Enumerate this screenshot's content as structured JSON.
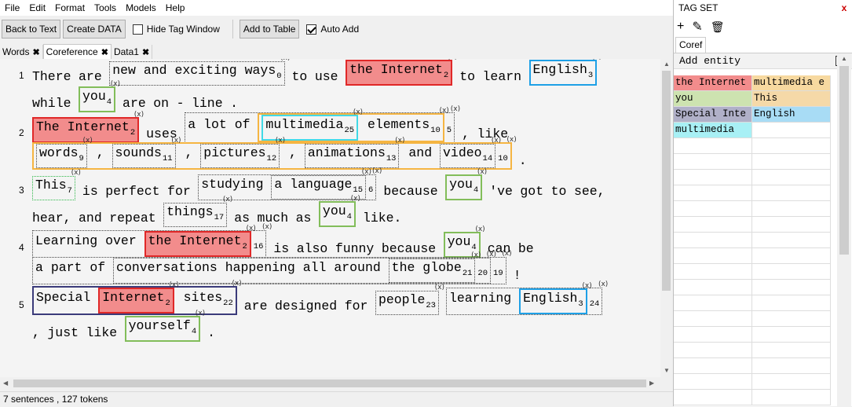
{
  "menu": [
    "File",
    "Edit",
    "Format",
    "Tools",
    "Models",
    "Help"
  ],
  "toolbar": {
    "back_to_text": "Back to Text",
    "create_data": "Create DATA",
    "hide_tag_window": "Hide Tag Window",
    "add_to_table": "Add to Table",
    "auto_add": "Auto Add",
    "hide_tag_window_checked": false,
    "auto_add_checked": true
  },
  "tabs": [
    "Words",
    "Coreference",
    "Data1"
  ],
  "tab_close_glyph": "✖",
  "mention_close_glyph": "(x)",
  "sentences": [
    {
      "num": "1",
      "lines": [
        [
          {
            "t": "There"
          },
          {
            "t": "are"
          },
          {
            "m": [
              "new",
              "and",
              "exciting",
              "ways"
            ],
            "i": "0",
            "s": "dot"
          },
          {
            "t": "to"
          },
          {
            "t": "use"
          },
          {
            "m": [
              "the",
              "Internet"
            ],
            "i": "2",
            "s": "red"
          },
          {
            "t": "to"
          },
          {
            "t": "learn"
          },
          {
            "m": [
              "English"
            ],
            "i": "3",
            "s": "blue"
          }
        ],
        [
          {
            "t": "while"
          },
          {
            "m": [
              "you"
            ],
            "i": "4",
            "s": "green"
          },
          {
            "t": "are"
          },
          {
            "t": "on"
          },
          {
            "t": "-"
          },
          {
            "t": "line"
          },
          {
            "t": "."
          }
        ]
      ]
    },
    {
      "num": "2",
      "lines": [
        [
          {
            "m": [
              "The",
              "Internet"
            ],
            "i": "2",
            "s": "red"
          },
          {
            "t": "uses"
          },
          {
            "m": [
              "a",
              "lot",
              "of",
              {
                "m": [
                  {
                    "m": [
                      "multimedia"
                    ],
                    "i": "25",
                    "s": "cyan"
                  },
                  "elements"
                ],
                "i": "10",
                "s": "orange"
              }
            ],
            "i": "5",
            "s": "dot"
          },
          {
            "t": ","
          },
          {
            "t": "like"
          }
        ],
        [
          {
            "m": [
              {
                "m": [
                  "words"
                ],
                "i": "9",
                "s": "dot"
              },
              ",",
              {
                "m": [
                  "sounds"
                ],
                "i": "11",
                "s": "dot"
              },
              ",",
              {
                "m": [
                  "pictures"
                ],
                "i": "12",
                "s": "dot"
              },
              ",",
              {
                "m": [
                  "animations"
                ],
                "i": "13",
                "s": "dot"
              },
              "and",
              {
                "m": [
                  "video"
                ],
                "i": "14",
                "s": "dot"
              }
            ],
            "i": "10",
            "s": "orange"
          },
          {
            "t": "."
          }
        ]
      ]
    },
    {
      "num": "3",
      "lines": [
        [
          {
            "m": [
              "This"
            ],
            "i": "7",
            "s": "gdot"
          },
          {
            "t": "is"
          },
          {
            "t": "perfect"
          },
          {
            "t": "for"
          },
          {
            "m": [
              "studying",
              {
                "m": [
                  "a",
                  "language"
                ],
                "i": "15",
                "s": "dot"
              }
            ],
            "i": "6",
            "s": "dot"
          },
          {
            "t": "because"
          },
          {
            "m": [
              "you"
            ],
            "i": "4",
            "s": "green"
          },
          {
            "t": "'ve"
          },
          {
            "t": "got"
          },
          {
            "t": "to"
          },
          {
            "t": "see,"
          }
        ],
        [
          {
            "t": "hear,"
          },
          {
            "t": "and"
          },
          {
            "t": "repeat"
          },
          {
            "m": [
              "things"
            ],
            "i": "17",
            "s": "dot"
          },
          {
            "t": "as"
          },
          {
            "t": "much"
          },
          {
            "t": "as"
          },
          {
            "m": [
              "you"
            ],
            "i": "4",
            "s": "green"
          },
          {
            "t": "like."
          }
        ]
      ]
    },
    {
      "num": "4",
      "lines": [
        [
          {
            "m": [
              "Learning",
              "over",
              {
                "m": [
                  "the",
                  "Internet"
                ],
                "i": "2",
                "s": "red"
              }
            ],
            "i": "16",
            "s": "dot"
          },
          {
            "t": "is"
          },
          {
            "t": "also"
          },
          {
            "t": "funny"
          },
          {
            "t": "because"
          },
          {
            "m": [
              "you"
            ],
            "i": "4",
            "s": "green"
          },
          {
            "t": "can"
          },
          {
            "t": "be"
          }
        ],
        [
          {
            "m": [
              "a",
              "part",
              "of",
              {
                "m": [
                  "conversations",
                  "happening",
                  "all",
                  "around",
                  {
                    "m": [
                      "the",
                      "globe"
                    ],
                    "i": "21",
                    "s": "dot"
                  }
                ],
                "i": "20",
                "s": "dot"
              }
            ],
            "i": "19",
            "s": "dot"
          },
          {
            "t": "!"
          }
        ]
      ]
    },
    {
      "num": "5",
      "lines": [
        [
          {
            "m": [
              "Special",
              {
                "m": [
                  "Internet"
                ],
                "i": "2",
                "s": "red"
              },
              "sites"
            ],
            "i": "22",
            "s": "navy"
          },
          {
            "t": "are"
          },
          {
            "t": "designed"
          },
          {
            "t": "for"
          },
          {
            "m": [
              "people"
            ],
            "i": "23",
            "s": "dot"
          },
          {
            "m": [
              "learning",
              {
                "m": [
                  "English"
                ],
                "i": "3",
                "s": "blue"
              }
            ],
            "i": "24",
            "s": "dot"
          }
        ],
        [
          {
            "t": ","
          },
          {
            "t": "just"
          },
          {
            "t": "like"
          },
          {
            "m": [
              "yourself"
            ],
            "i": "4",
            "s": "green"
          },
          {
            "t": "."
          }
        ]
      ]
    }
  ],
  "status": "7 sentences , 127 tokens",
  "tagset": {
    "title": "TAG SET",
    "close": "x",
    "tab": "Coref",
    "add_entity": "Add entity",
    "add_entity_close": "x",
    "tools": [
      "+",
      "✎",
      "🗑"
    ],
    "rows": [
      [
        {
          "text": "the Internet",
          "color": "#f28c8c"
        },
        {
          "text": "multimedia e",
          "color": "#f7d9a0"
        }
      ],
      [
        {
          "text": "you",
          "color": "#cde3b0"
        },
        {
          "text": "This",
          "color": "#f5d9a8"
        }
      ],
      [
        {
          "text": "Special Inte",
          "color": "#b0b0c8"
        },
        {
          "text": "English",
          "color": "#a8dcf5"
        }
      ],
      [
        {
          "text": "multimedia",
          "color": "#a8f0f5"
        },
        {
          "text": "",
          "color": "#ffffff"
        }
      ],
      [
        {
          "text": "",
          "color": "#ffffff"
        },
        {
          "text": "",
          "color": "#ffffff"
        }
      ],
      [
        {
          "text": "",
          "color": "#ffffff"
        },
        {
          "text": "",
          "color": "#ffffff"
        }
      ],
      [
        {
          "text": "",
          "color": "#ffffff"
        },
        {
          "text": "",
          "color": "#ffffff"
        }
      ],
      [
        {
          "text": "",
          "color": "#ffffff"
        },
        {
          "text": "",
          "color": "#ffffff"
        }
      ],
      [
        {
          "text": "",
          "color": "#ffffff"
        },
        {
          "text": "",
          "color": "#ffffff"
        }
      ],
      [
        {
          "text": "",
          "color": "#ffffff"
        },
        {
          "text": "",
          "color": "#ffffff"
        }
      ],
      [
        {
          "text": "",
          "color": "#ffffff"
        },
        {
          "text": "",
          "color": "#ffffff"
        }
      ],
      [
        {
          "text": "",
          "color": "#ffffff"
        },
        {
          "text": "",
          "color": "#ffffff"
        }
      ],
      [
        {
          "text": "",
          "color": "#ffffff"
        },
        {
          "text": "",
          "color": "#ffffff"
        }
      ],
      [
        {
          "text": "",
          "color": "#ffffff"
        },
        {
          "text": "",
          "color": "#ffffff"
        }
      ],
      [
        {
          "text": "",
          "color": "#ffffff"
        },
        {
          "text": "",
          "color": "#ffffff"
        }
      ],
      [
        {
          "text": "",
          "color": "#ffffff"
        },
        {
          "text": "",
          "color": "#ffffff"
        }
      ],
      [
        {
          "text": "",
          "color": "#ffffff"
        },
        {
          "text": "",
          "color": "#ffffff"
        }
      ],
      [
        {
          "text": "",
          "color": "#ffffff"
        },
        {
          "text": "",
          "color": "#ffffff"
        }
      ],
      [
        {
          "text": "",
          "color": "#ffffff"
        },
        {
          "text": "",
          "color": "#ffffff"
        }
      ],
      [
        {
          "text": "",
          "color": "#ffffff"
        },
        {
          "text": "",
          "color": "#ffffff"
        }
      ],
      [
        {
          "text": "",
          "color": "#ffffff"
        },
        {
          "text": "",
          "color": "#ffffff"
        }
      ]
    ]
  }
}
